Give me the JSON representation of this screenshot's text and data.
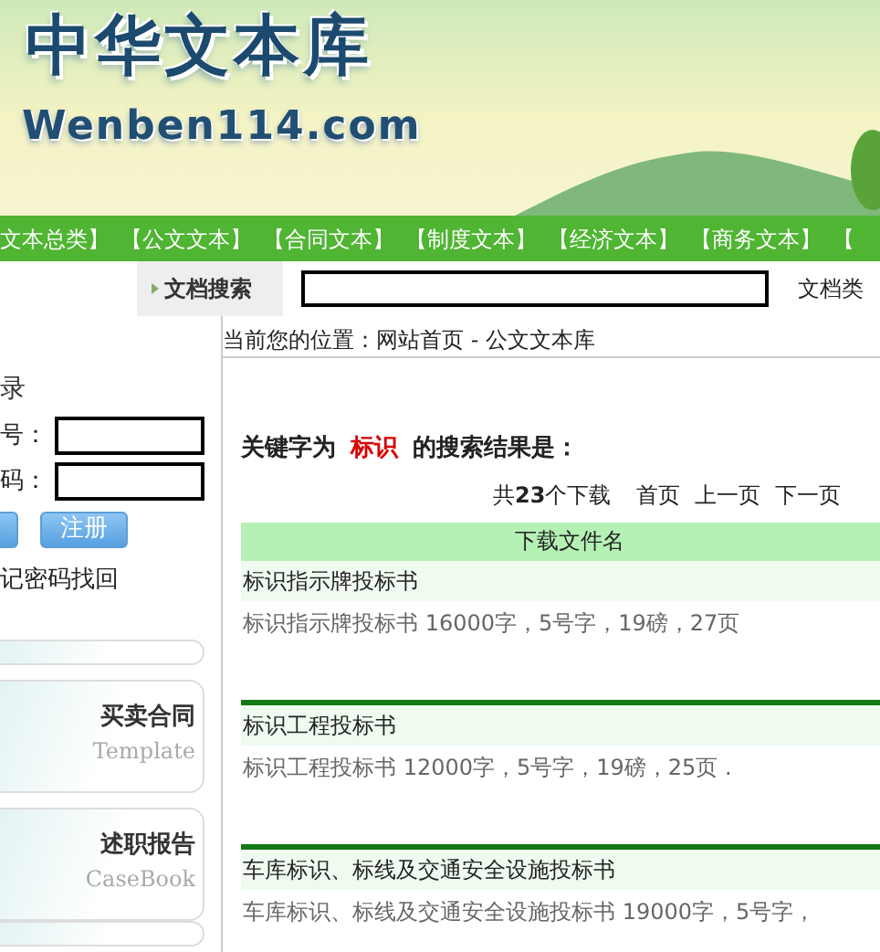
{
  "header": {
    "logo_title": "中华文本库",
    "logo_domain": "Wenben114.com"
  },
  "nav": [
    "文本总类】",
    "【公文文本】",
    "【合同文本】",
    "【制度文本】",
    "【经济文本】",
    "【商务文本】",
    "【"
  ],
  "search": {
    "label": "文档搜索",
    "next_label": "文档类"
  },
  "login": {
    "title": "录",
    "fields": [
      {
        "label": "号："
      },
      {
        "label": "码："
      }
    ],
    "register_button": "注册",
    "forgot_link": "记密码找回"
  },
  "side_panels": [
    {
      "title": "买卖合同",
      "subtitle": "Template"
    },
    {
      "title": "述职报告",
      "subtitle": "CaseBook"
    }
  ],
  "breadcrumb": "当前您的位置：网站首页 - 公文文本库",
  "result_heading": {
    "prefix": "关键字为",
    "keyword": "标识",
    "suffix": "的搜索结果是："
  },
  "pager": {
    "total": "共**23**个下载",
    "links": [
      "首页",
      "上一页",
      "下一页"
    ]
  },
  "table": {
    "column": "下载文件名",
    "rows": [
      {
        "title": "标识指示牌投标书",
        "description": "标识指示牌投标书 16000字，5号字，19磅，27页"
      },
      {
        "title": "标识工程投标书",
        "description": "标识工程投标书 12000字，5号字，19磅，25页 ."
      },
      {
        "title": "车库标识、标线及交通安全设施投标书",
        "description": "车库标识、标线及交通安全设施投标书 19000字，5号字，"
      }
    ]
  }
}
